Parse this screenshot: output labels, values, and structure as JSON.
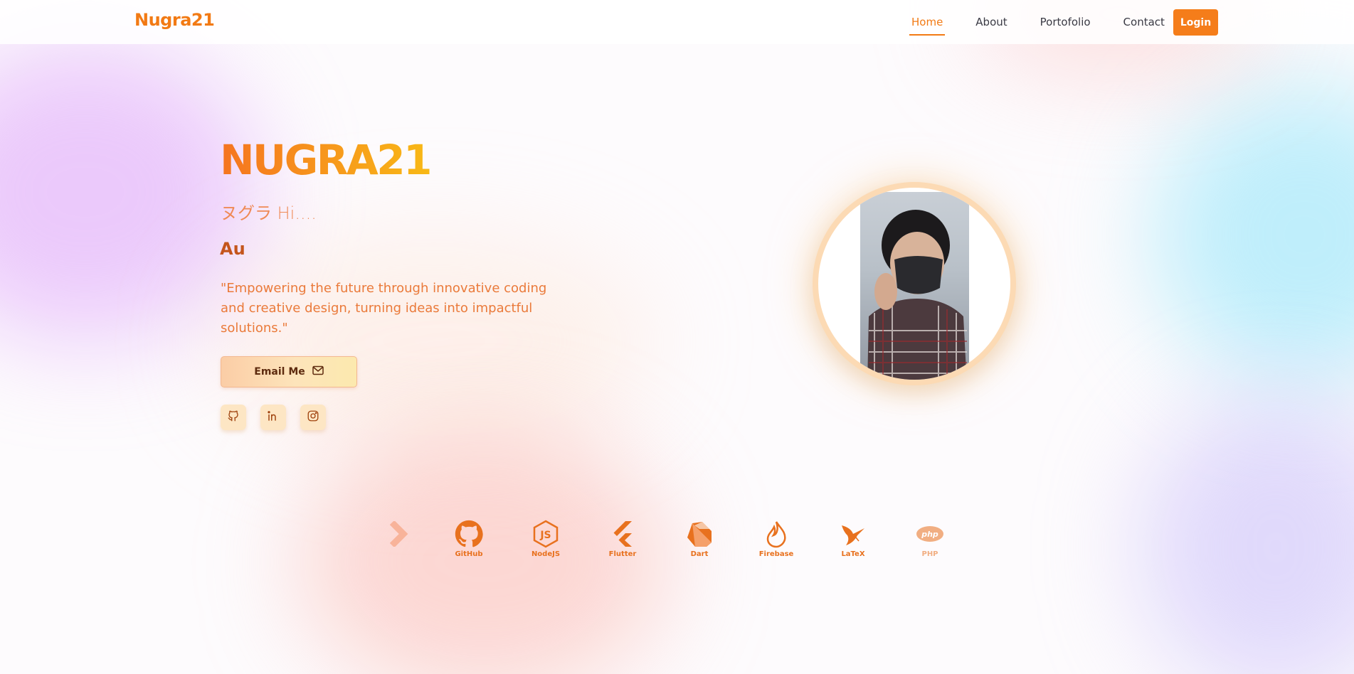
{
  "nav": {
    "brand": "Nugra21",
    "links": [
      {
        "label": "Home",
        "active": true
      },
      {
        "label": "About",
        "active": false
      },
      {
        "label": "Portofolio",
        "active": false
      },
      {
        "label": "Contact",
        "active": false
      }
    ],
    "login_label": "Login"
  },
  "hero": {
    "title": "NUGRA21",
    "greeting": "ヌグラ Hi....",
    "name": "Au",
    "quote": "\"Empowering the future through innovative coding and creative design, turning ideas into impactful solutions.\"",
    "email_button": "Email Me",
    "socials": [
      {
        "icon": "github-icon"
      },
      {
        "icon": "linkedin-icon"
      },
      {
        "icon": "instagram-icon"
      }
    ]
  },
  "profile": {
    "photo": "profile-photo"
  },
  "tech": [
    {
      "label": "GitHub",
      "icon": "github-icon"
    },
    {
      "label": "NodeJS",
      "icon": "nodejs-icon"
    },
    {
      "label": "Flutter",
      "icon": "flutter-icon"
    },
    {
      "label": "Dart",
      "icon": "dart-icon"
    },
    {
      "label": "Firebase",
      "icon": "firebase-icon"
    },
    {
      "label": "LaTeX",
      "icon": "latex-icon"
    },
    {
      "label": "PHP",
      "icon": "php-icon"
    }
  ],
  "colors": {
    "accent": "#f27a14",
    "login_bg": "#f57d1a",
    "text_dark": "#3a3a44",
    "quote_text": "#ea7a3a",
    "name_text": "#c4551c",
    "ring": "#fcdab4"
  }
}
